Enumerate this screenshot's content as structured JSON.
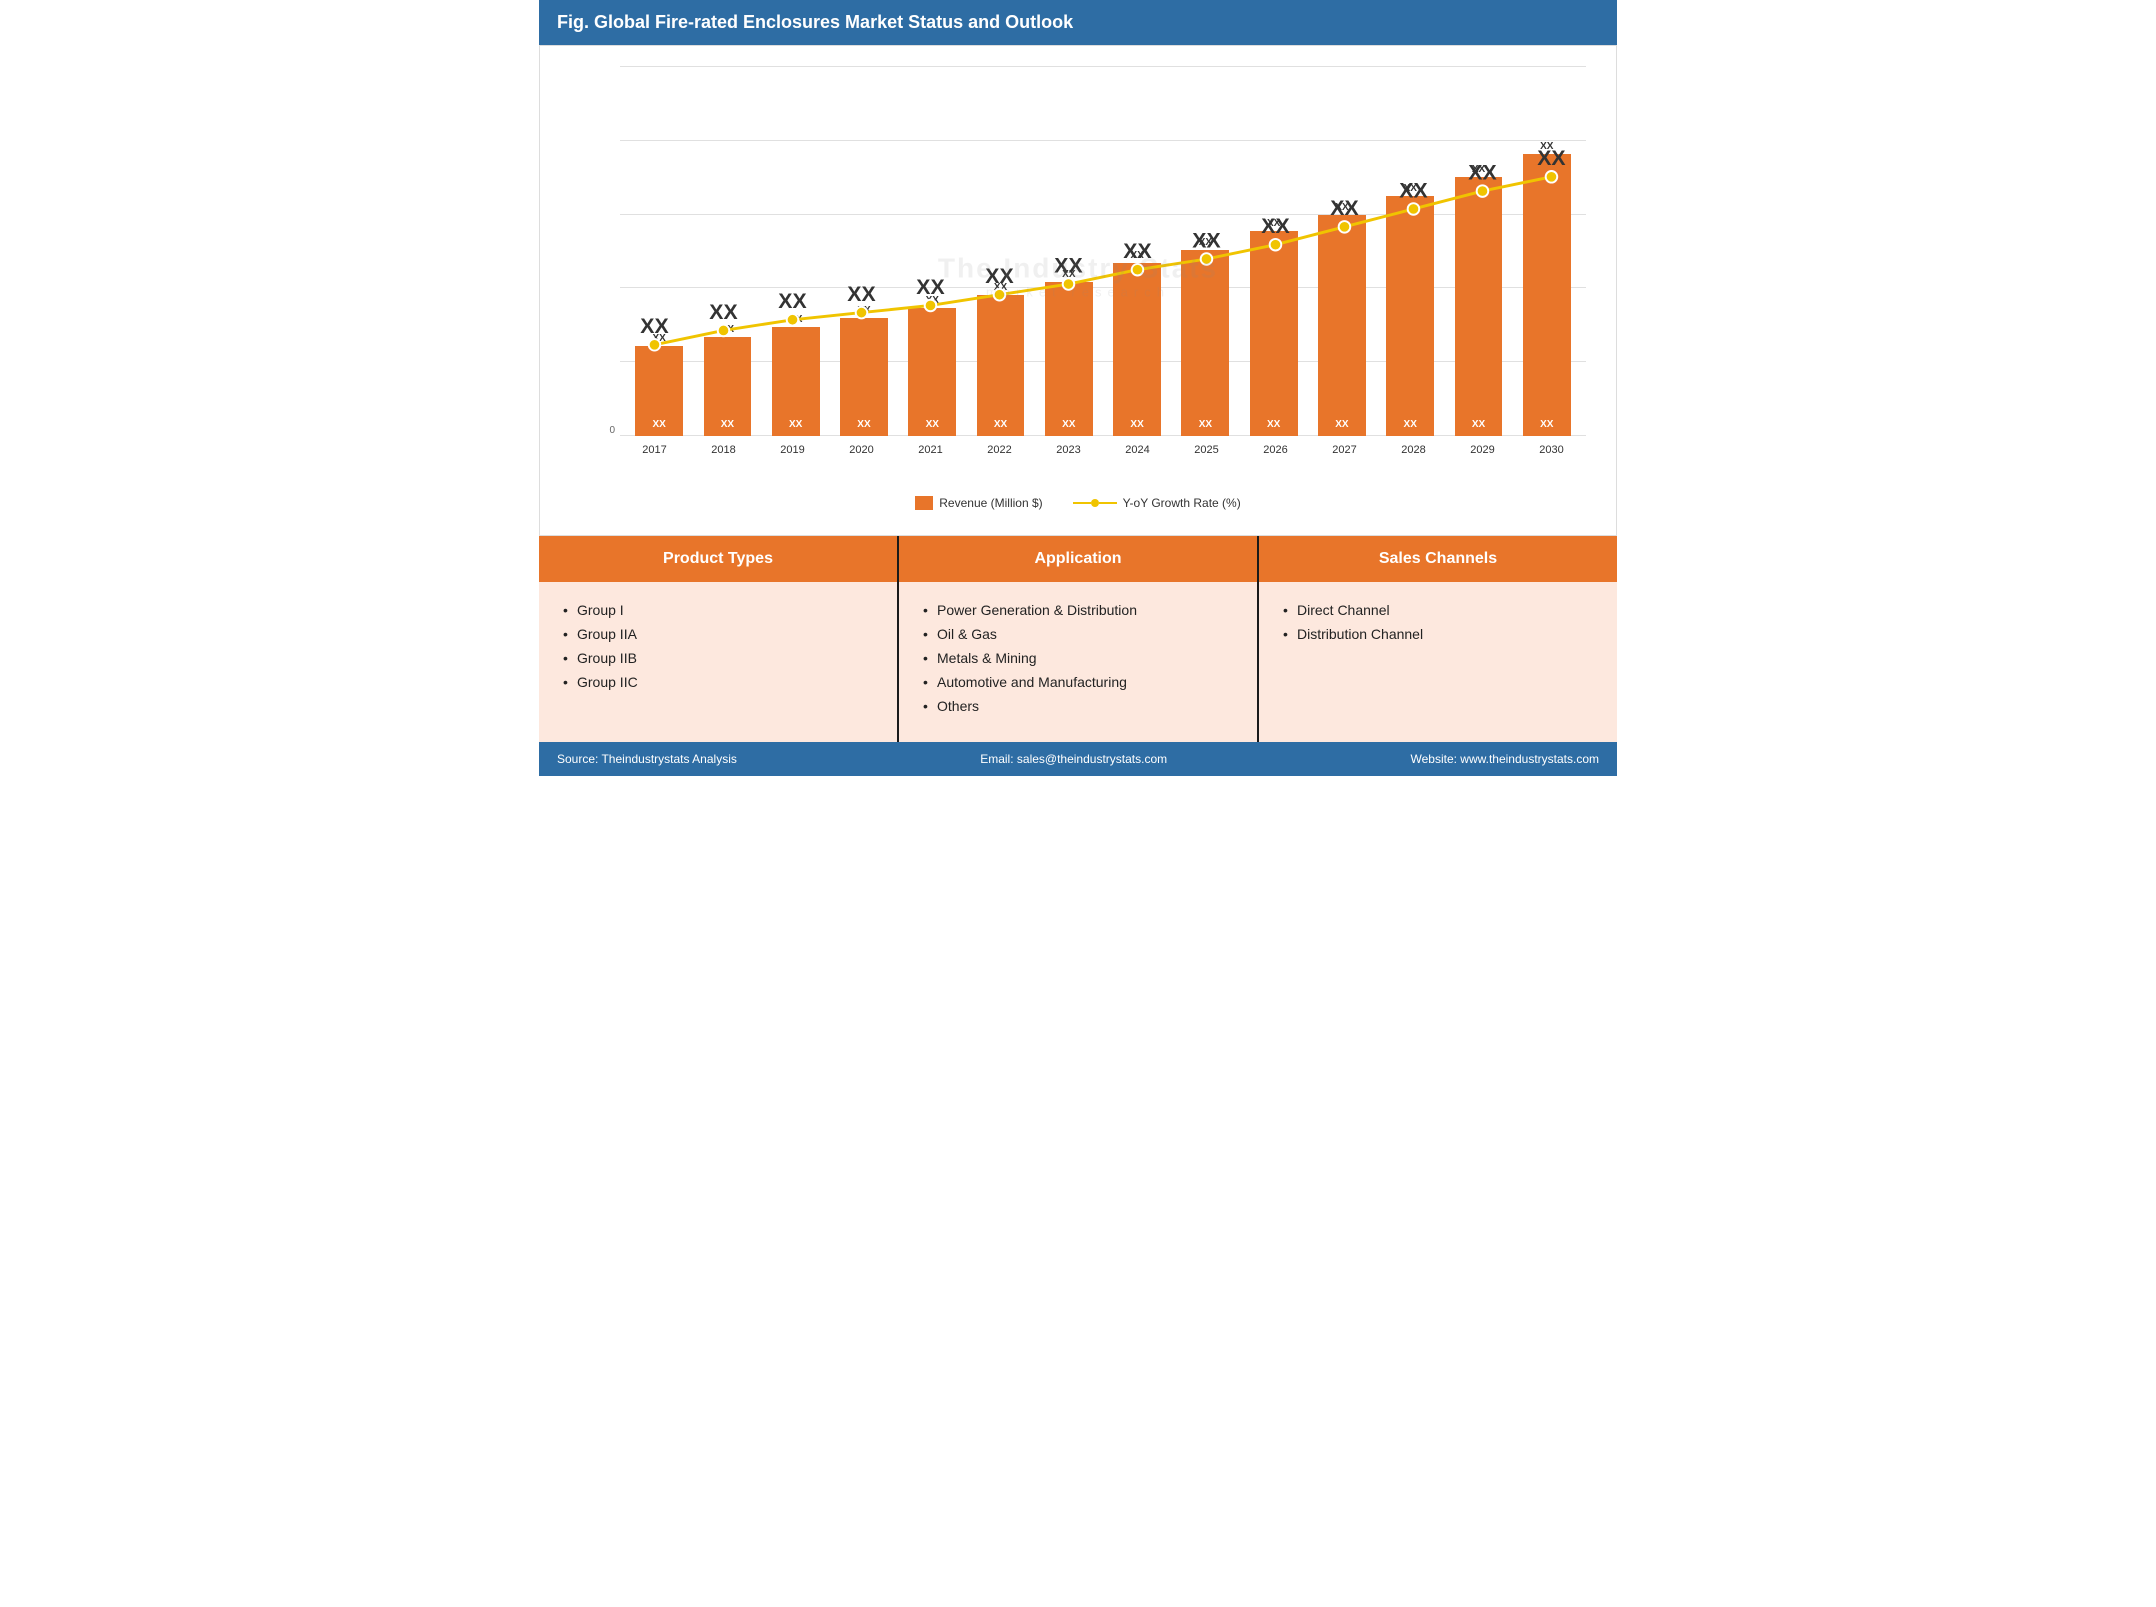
{
  "header": {
    "title": "Fig. Global Fire-rated Enclosures Market Status and Outlook"
  },
  "chart": {
    "years": [
      "2017",
      "2018",
      "2019",
      "2020",
      "2021",
      "2022",
      "2023",
      "2024",
      "2025",
      "2026",
      "2027",
      "2028",
      "2029",
      "2030"
    ],
    "bar_heights_pct": [
      28,
      31,
      34,
      37,
      40,
      44,
      48,
      54,
      58,
      64,
      69,
      75,
      81,
      88
    ],
    "bar_top_labels": [
      "XX",
      "XX",
      "XX",
      "XX",
      "XX",
      "XX",
      "XX",
      "XX",
      "XX",
      "XX",
      "XX",
      "XX",
      "XX",
      "XX"
    ],
    "bar_bottom_labels": [
      "XX",
      "XX",
      "XX",
      "XX",
      "XX",
      "XX",
      "XX",
      "XX",
      "XX",
      "XX",
      "XX",
      "XX",
      "XX",
      "XX"
    ],
    "line_heights_pct": [
      22,
      26,
      29,
      31,
      33,
      36,
      39,
      43,
      46,
      50,
      55,
      60,
      65,
      69
    ],
    "line_top_labels": [
      "XX",
      "XX",
      "XX",
      "XX",
      "XX",
      "XX",
      "XX",
      "XX",
      "XX",
      "XX",
      "XX",
      "XX",
      "XX",
      "XX"
    ],
    "legend": {
      "bar_label": "Revenue (Million $)",
      "line_label": "Y-oY Growth Rate (%)"
    }
  },
  "categories": {
    "product_types": {
      "header": "Product Types",
      "items": [
        "Group I",
        "Group IIA",
        "Group IIB",
        "Group IIC"
      ]
    },
    "application": {
      "header": "Application",
      "items": [
        "Power Generation & Distribution",
        "Oil & Gas",
        "Metals & Mining",
        "Automotive and Manufacturing",
        "Others"
      ]
    },
    "sales_channels": {
      "header": "Sales Channels",
      "items": [
        "Direct Channel",
        "Distribution Channel"
      ]
    }
  },
  "footer": {
    "source": "Source: Theindustrystats Analysis",
    "email": "Email: sales@theindustrystats.com",
    "website": "Website: www.theindustrystats.com"
  },
  "watermark": {
    "line1": "The Industry Stats",
    "line2": "market  research"
  }
}
